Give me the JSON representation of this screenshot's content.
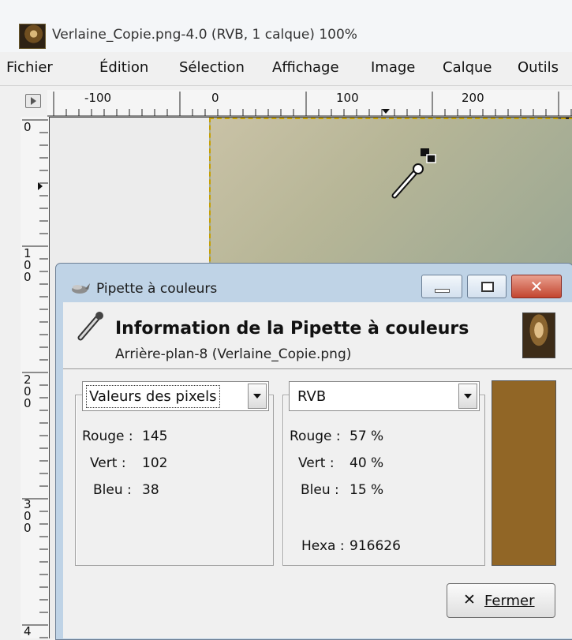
{
  "window": {
    "title": "Verlaine_Copie.png-4.0 (RVB, 1 calque) 100%"
  },
  "menubar": {
    "items": [
      "Fichier",
      "Édition",
      "Sélection",
      "Affichage",
      "Image",
      "Calque",
      "Outils"
    ]
  },
  "rulers": {
    "horizontal_labels": [
      "-100",
      "0",
      "100",
      "200"
    ],
    "vertical_labels": [
      "0",
      "1\n0\n0",
      "2\n0\n0",
      "3\n0\n0",
      "4"
    ]
  },
  "dialog": {
    "title": "Pipette à couleurs",
    "header_title": "Information de la Pipette à couleurs",
    "header_subtitle": "Arrière-plan-8 (Verlaine_Copie.png)",
    "left_panel": {
      "mode": "Valeurs des pixels",
      "rows": [
        {
          "label": "Rouge :",
          "value": "145"
        },
        {
          "label": "Vert :",
          "value": "102"
        },
        {
          "label": "Bleu :",
          "value": "38"
        }
      ]
    },
    "right_panel": {
      "mode": "RVB",
      "rows": [
        {
          "label": "Rouge :",
          "value": "57 %"
        },
        {
          "label": "Vert :",
          "value": "40 %"
        },
        {
          "label": "Bleu :",
          "value": "15 %"
        }
      ],
      "hex_label": "Hexa :",
      "hex_value": "916626"
    },
    "swatch_color": "#916626",
    "close_label": "Fermer"
  },
  "icons": {
    "app": "image-thumbnail-icon",
    "dialog": "color-picker-icon",
    "header": "eyedropper-icon"
  }
}
